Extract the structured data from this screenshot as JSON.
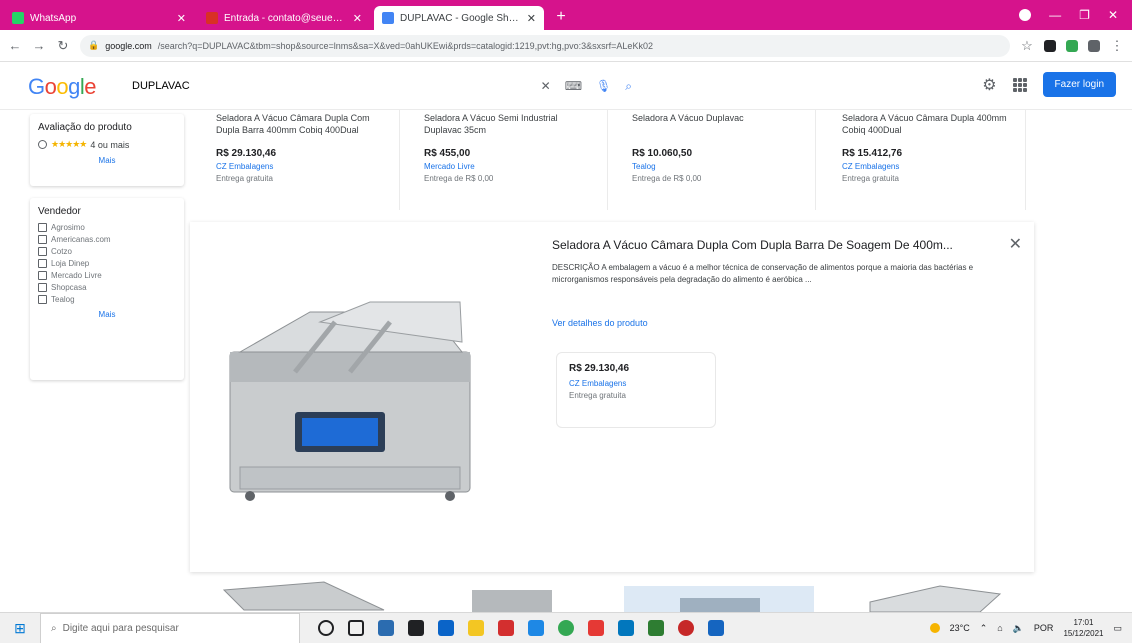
{
  "browser": {
    "tabs": [
      {
        "title": "WhatsApp",
        "color": "#25d366"
      },
      {
        "title": "Entrada - contato@seuemail.com",
        "color": "#d93025"
      },
      {
        "title": "DUPLAVAC - Google Shopping",
        "color": "#4285f4",
        "active": true
      }
    ],
    "url_host": "google.com",
    "url_rest": "/search?q=DUPLAVAC&tbm=shop&source=lnms&sa=X&ved=0ahUKEwi&prds=catalogid:1219,pvt:hg,pvo:3&sxsrf=ALeKk02"
  },
  "google": {
    "search_value": "DUPLAVAC",
    "signin_label": "Fazer login"
  },
  "sidebar": {
    "rating": {
      "title": "Avaliação do produto",
      "stars": "★★★★★",
      "option": "4 ou mais",
      "more": "Mais"
    },
    "sellers": {
      "title": "Vendedor",
      "items": [
        "Agrosimo",
        "Americanas.com",
        "Cotzo",
        "Loja Dinep",
        "Mercado Livre",
        "Shopcasa",
        "Tealog"
      ],
      "more": "Mais"
    }
  },
  "products": [
    {
      "title": "Seladora A Vácuo Câmara Dupla Com Dupla Barra 400mm Cobiq 400Dual",
      "price": "R$ 29.130,46",
      "store": "CZ Embalagens",
      "ship": "Entrega gratuita"
    },
    {
      "title": "Seladora A Vácuo Semi Industrial Duplavac 35cm",
      "price": "R$ 455,00",
      "store": "Mercado Livre",
      "ship": "Entrega de R$ 0,00"
    },
    {
      "title": "Seladora A Vácuo Duplavac",
      "price": "R$ 10.060,50",
      "store": "Tealog",
      "ship": "Entrega de R$ 0,00"
    },
    {
      "title": "Seladora A Vácuo Câmara Dupla 400mm Cobiq 400Dual",
      "price": "R$ 15.412,76",
      "store": "CZ Embalagens",
      "ship": "Entrega gratuita"
    }
  ],
  "detail": {
    "title": "Seladora A Vácuo Câmara Dupla Com Dupla Barra De Soagem De 400m...",
    "description": "DESCRIÇÃO A embalagem a vácuo é a melhor técnica de conservação de alimentos porque a maioria das bactérias e microrganismos responsáveis pela degradação do alimento é aeróbica ...",
    "link": "Ver detalhes do produto",
    "offer": {
      "price": "R$ 29.130,46",
      "store": "CZ Embalagens",
      "ship": "Entrega gratuita"
    }
  },
  "taskbar": {
    "search_placeholder": "Digite aqui para pesquisar",
    "weather": "23°C",
    "lang": "POR",
    "time": "17:01",
    "date": "15/12/2021"
  }
}
